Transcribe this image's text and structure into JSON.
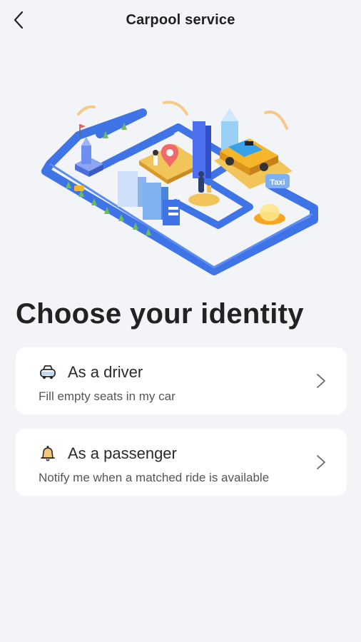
{
  "header": {
    "title": "Carpool service",
    "back_icon": "chevron-left-icon"
  },
  "illustration": {
    "sign_text": "Taxi"
  },
  "main": {
    "heading": "Choose your identity",
    "options": [
      {
        "title": "As a driver",
        "subtitle": "Fill empty seats in my car",
        "icon": "car-icon"
      },
      {
        "title": "As a passenger",
        "subtitle": "Notify me when a matched ride is available",
        "icon": "bell-icon"
      }
    ]
  },
  "colors": {
    "background": "#f3f4f8",
    "card": "#ffffff",
    "road": "#3f74e6",
    "taxi": "#f5b62a"
  }
}
